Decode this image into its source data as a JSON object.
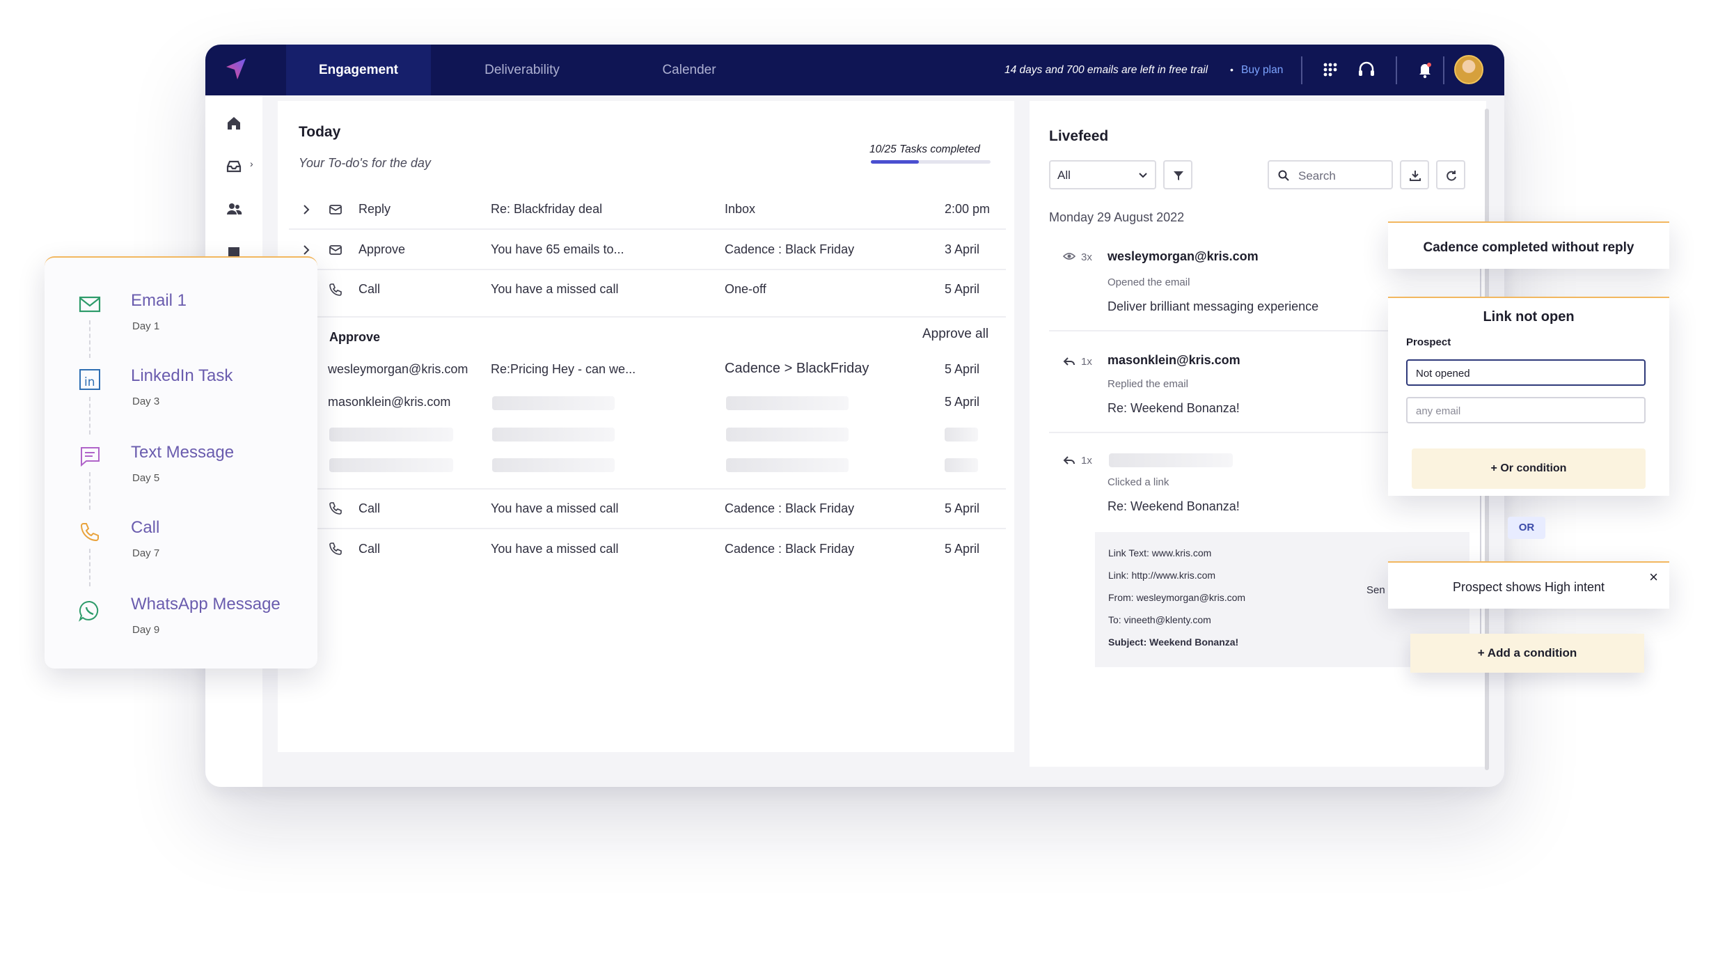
{
  "colors": {
    "navbar": "#0f1554",
    "accent": "#4a4fd0",
    "card_top": "#f2b75f",
    "sequence_text": "#6a5cae"
  },
  "topbar": {
    "tabs": [
      {
        "label": "Engagement",
        "active": true
      },
      {
        "label": "Deliverability",
        "active": false
      },
      {
        "label": "Calender",
        "active": false
      }
    ],
    "trial_text": "14 days and 700 emails are left in free trail",
    "separator": "•",
    "buy_plan": "Buy plan",
    "icons": [
      "logo-icon",
      "apps-grid-icon",
      "headset-icon",
      "bell-icon",
      "avatar"
    ]
  },
  "left_rail": {
    "icons": [
      "home-icon",
      "inbox-icon",
      "contacts-icon",
      "cadence-icon"
    ],
    "chevron": "›"
  },
  "todo": {
    "title": "Today",
    "subtitle": "Your To-do's for the day",
    "progress_label": "10/25 Tasks completed",
    "progress_fraction": 0.4,
    "rows": [
      {
        "type": "Reply",
        "subject": "Re: Blackfriday deal",
        "source": "Inbox",
        "time": "2:00 pm"
      },
      {
        "type": "Approve",
        "subject": "You have 65 emails to...",
        "source": "Cadence : Black Friday",
        "time": "3 April"
      },
      {
        "type": "Call",
        "subject": "You have a missed call",
        "source": "One-off",
        "time": "5 April"
      }
    ],
    "approve": {
      "title": "Approve",
      "approve_all": "Approve all",
      "rows": [
        {
          "email": "wesleymorgan@kris.com",
          "subject": "Re:Pricing Hey - can we...",
          "cadence": "Cadence > BlackFriday",
          "date": "5 April"
        },
        {
          "email": "masonklein@kris.com",
          "date": "5 April"
        }
      ]
    },
    "bottom_rows": [
      {
        "type": "Call",
        "subject": "You have a missed call",
        "source": "Cadence : Black Friday",
        "time": "5 April"
      },
      {
        "type": "Call",
        "subject": "You have a missed call",
        "source": "Cadence : Black Friday",
        "time": "5 April"
      }
    ]
  },
  "livefeed": {
    "title": "Livefeed",
    "filter_value": "All",
    "search_placeholder": "Search",
    "date": "Monday 29 August 2022",
    "events": [
      {
        "count": "3x",
        "who": "wesleymorgan@kris.com",
        "action": "Opened the email",
        "message": "Deliver brilliant messaging experience"
      },
      {
        "count": "1x",
        "who": "masonklein@kris.com",
        "action": "Replied the email",
        "message": "Re: Weekend Bonanza!"
      },
      {
        "count": "1x",
        "action": "Clicked a link",
        "message": "Re: Weekend Bonanza!"
      }
    ],
    "link_details": {
      "link_text": "Link Text: www.kris.com",
      "link": "Link: http://www.kris.com",
      "from": "From: wesleymorgan@kris.com",
      "to": "To: vineeth@klenty.com",
      "subject": "Subject: Weekend Bonanza!",
      "truncated": "Sen"
    }
  },
  "sequence": [
    {
      "name": "Email 1",
      "day": "Day 1",
      "icon": "email-icon",
      "color": "#2e9b6a"
    },
    {
      "name": "LinkedIn Task",
      "day": "Day 3",
      "icon": "linkedin-icon",
      "color": "#2f6fb3"
    },
    {
      "name": "Text Message",
      "day": "Day 5",
      "icon": "message-icon",
      "color": "#b064c9"
    },
    {
      "name": "Call",
      "day": "Day 7",
      "icon": "phone-icon",
      "color": "#e9a23b"
    },
    {
      "name": "WhatsApp Message",
      "day": "Day 9",
      "icon": "whatsapp-icon",
      "color": "#2e9b6a"
    }
  ],
  "conditions": {
    "completed": "Cadence completed without reply",
    "link_not_open": "Link not open",
    "prospect_label": "Prospect",
    "field_value": "Not opened",
    "field_placeholder": "any email",
    "or_condition": "+ Or condition",
    "or_pill": "OR",
    "high_intent": "Prospect shows High intent",
    "close": "×",
    "add_condition": "+ Add a condition"
  }
}
